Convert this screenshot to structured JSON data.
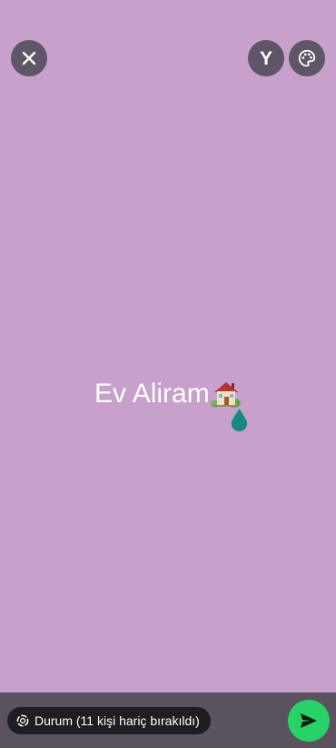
{
  "colors": {
    "background": "#c7a1cc",
    "button_bg": "#5f5566",
    "bottom_bar": "#5b5260",
    "chip_bg": "#1f1c22",
    "send": "#25d366",
    "cursor_handle": "#128c7e"
  },
  "toolbar": {
    "close_icon": "close-icon",
    "font_button_label": "Y",
    "palette_icon": "palette-icon"
  },
  "editor": {
    "text": "Ev Aliram",
    "emoji_icon": "house-with-garden-icon"
  },
  "status": {
    "privacy_label": "Durum (11 kişi hariç bırakıldı)",
    "privacy_icon": "status-ring-icon"
  },
  "send": {
    "icon": "send-icon"
  }
}
